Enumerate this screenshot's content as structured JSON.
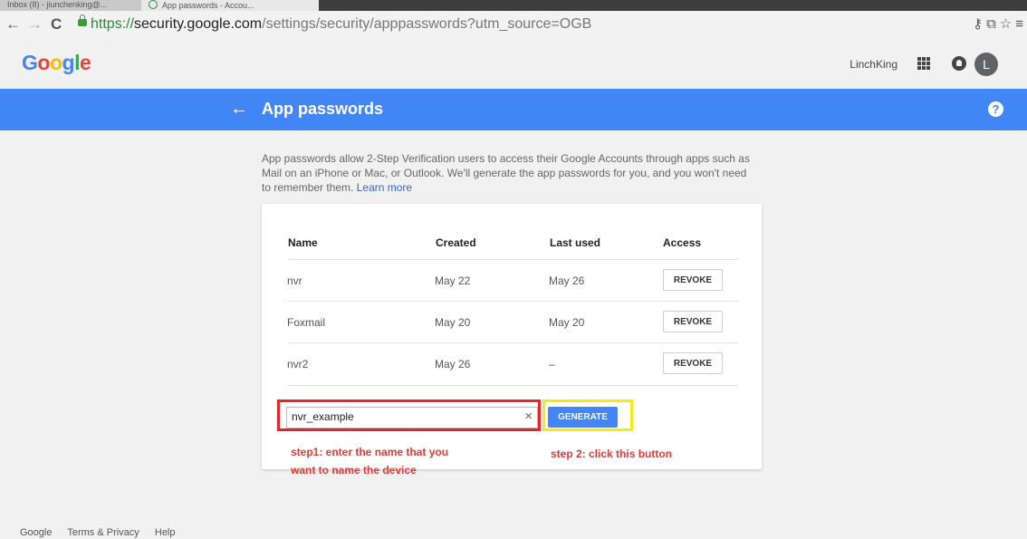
{
  "browser": {
    "tabs": [
      {
        "label": "Inbox (8) - jiunchenking@..."
      },
      {
        "label": "App passwords - Accou..."
      }
    ],
    "url": {
      "scheme": "https://",
      "host": "security.google.com",
      "path": "/settings/security/apppasswords?utm_source=OGB"
    }
  },
  "header": {
    "account_name": "LinchKing",
    "avatar_letter": "L"
  },
  "bluebar": {
    "back_glyph": "←",
    "title": "App passwords",
    "help_glyph": "?"
  },
  "intro": {
    "text": "App passwords allow 2-Step Verification users to access their Google Accounts through apps such as Mail on an iPhone or Mac, or Outlook. We'll generate the app passwords for you, and you won't need to remember them.",
    "link": "Learn more"
  },
  "table": {
    "headers": {
      "name": "Name",
      "created": "Created",
      "last_used": "Last used",
      "access": "Access"
    },
    "rows": [
      {
        "name": "nvr",
        "created": "May 22",
        "last_used": "May 26",
        "action": "REVOKE"
      },
      {
        "name": "Foxmail",
        "created": "May 20",
        "last_used": "May 20",
        "action": "REVOKE"
      },
      {
        "name": "nvr2",
        "created": "May 26",
        "last_used": "–",
        "action": "REVOKE"
      }
    ]
  },
  "generate_form": {
    "input_value": "nvr_example",
    "clear_glyph": "×",
    "button_label": "GENERATE"
  },
  "annotations": {
    "step1_line1": "step1: enter the name that you",
    "step1_line2": "want to name the device",
    "step2": "step 2: click this button",
    "color": "#e53935"
  },
  "footer": {
    "links": [
      "Google",
      "Terms & Privacy",
      "Help"
    ]
  },
  "colors": {
    "accent_blue": "#4285f4",
    "highlight_red": "#e8262a",
    "highlight_yellow": "#f4ea16"
  }
}
